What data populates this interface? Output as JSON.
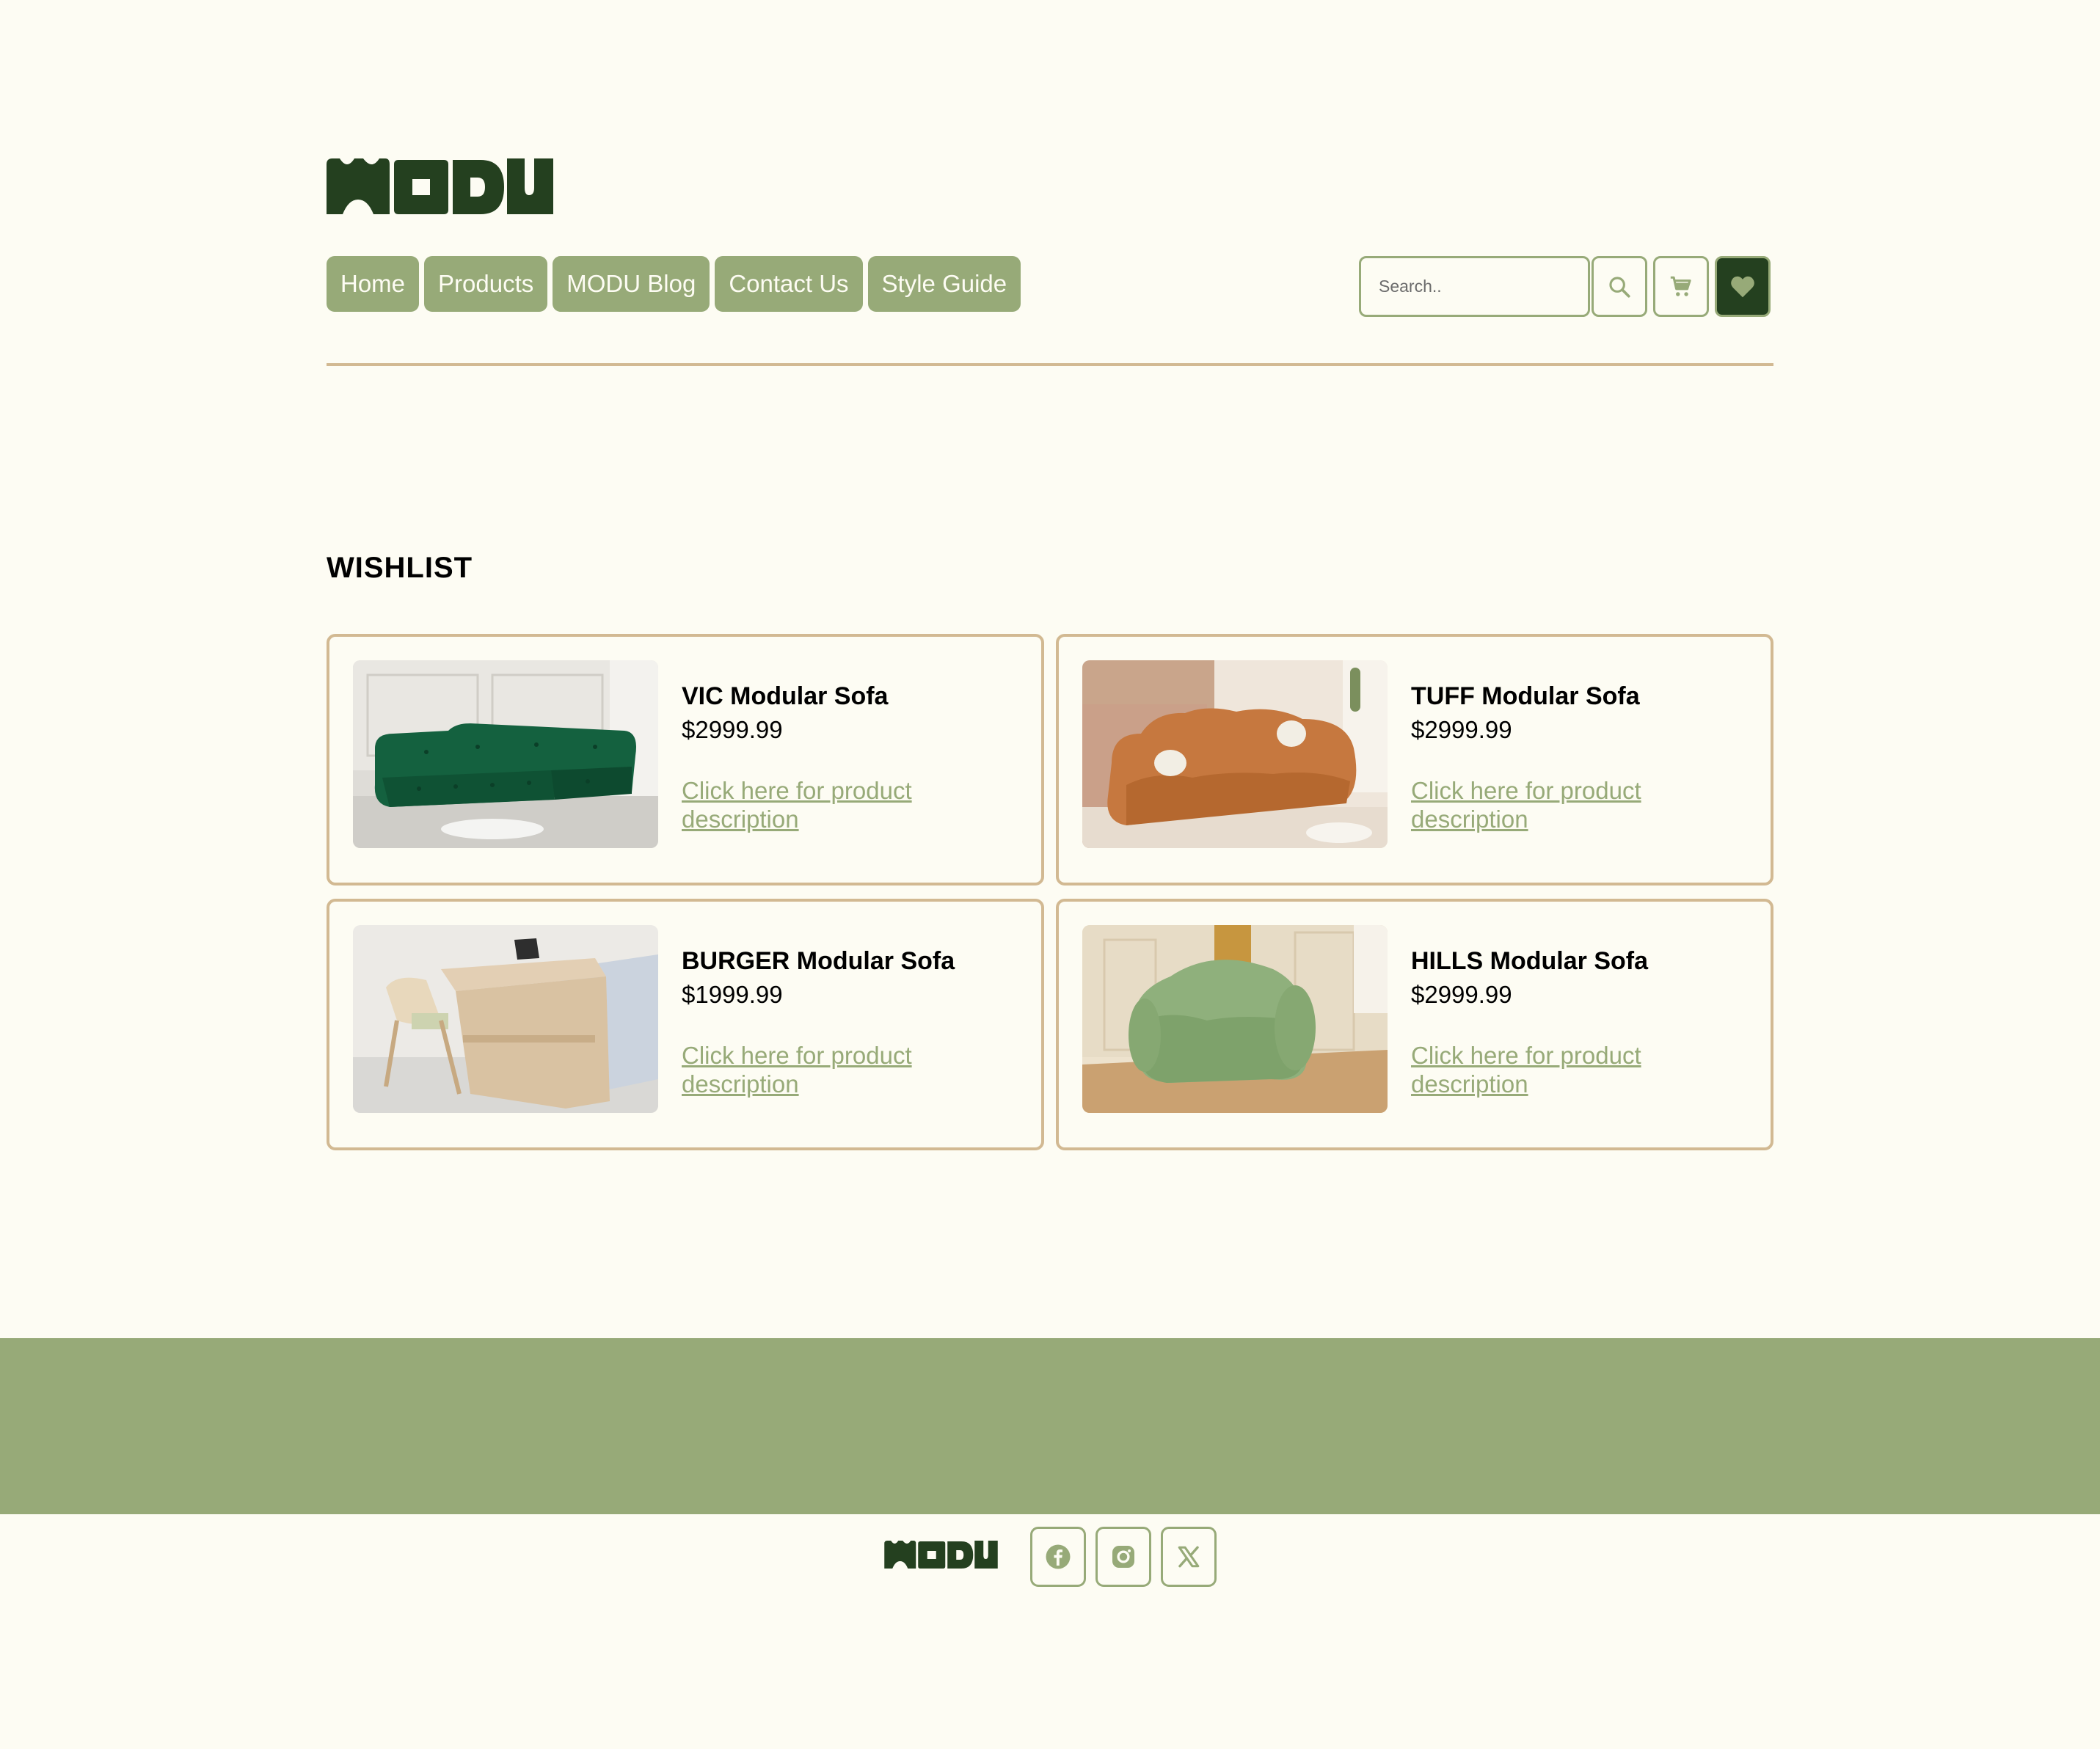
{
  "brand": {
    "logo_alt": "MODU",
    "colors": {
      "primary": "#97aa78",
      "dark": "#24401f",
      "accent": "#d2b992",
      "background": "#fdfcf3"
    }
  },
  "nav": {
    "items": [
      "Home",
      "Products",
      "MODU Blog",
      "Contact Us",
      "Style Guide"
    ]
  },
  "search": {
    "placeholder": "Search.."
  },
  "header_icons": [
    "search-icon",
    "cart-icon",
    "heart-icon"
  ],
  "wishlist": {
    "title": "WISHLIST",
    "items": [
      {
        "name": "VIC Modular Sofa",
        "price": "$2999.99",
        "link": "Click here for product description",
        "image": "green-velvet-sectional"
      },
      {
        "name": "TUFF Modular Sofa",
        "price": "$2999.99",
        "link": "Click here for product description",
        "image": "orange-puffy-sofa"
      },
      {
        "name": "BURGER Modular Sofa",
        "price": "$1999.99",
        "link": "Click here for product description",
        "image": "bed-with-desk"
      },
      {
        "name": "HILLS Modular Sofa",
        "price": "$2999.99",
        "link": "Click here for product description",
        "image": "green-armchair"
      }
    ]
  },
  "footer": {
    "social": [
      "facebook-icon",
      "instagram-icon",
      "x-icon"
    ]
  }
}
